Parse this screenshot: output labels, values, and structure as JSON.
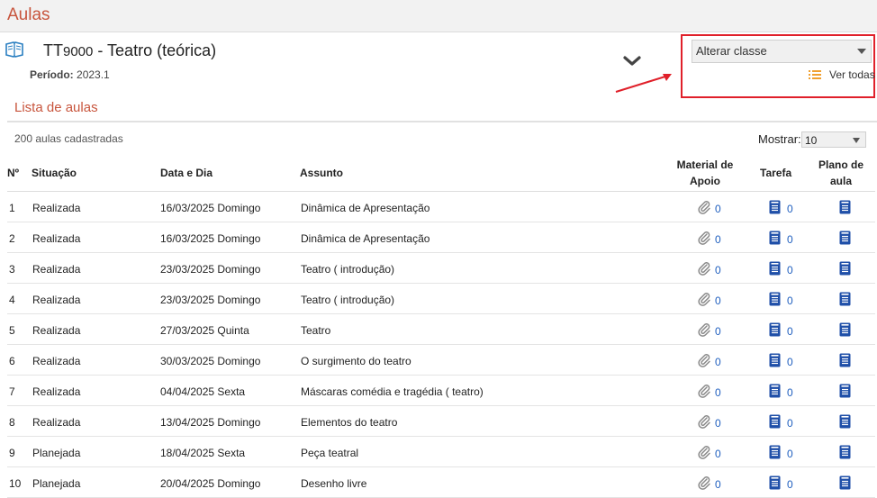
{
  "page": {
    "title": "Aulas"
  },
  "course": {
    "code_letters": "TT",
    "code_number": "9000",
    "name_suffix": " - Teatro (teórica)",
    "period_label": "Período:",
    "period_value": "2023.1"
  },
  "class_selector": {
    "label": "Alterar classe",
    "ver_todas": "Ver todas"
  },
  "list": {
    "title": "Lista de aulas",
    "count_text": "200 aulas cadastradas",
    "mostrar_label": "Mostrar:",
    "mostrar_value": "10"
  },
  "table": {
    "headers": {
      "num": "Nº",
      "situacao": "Situação",
      "data": "Data e Dia",
      "assunto": "Assunto",
      "material_1": "Material de",
      "material_2": "Apoio",
      "tarefa": "Tarefa",
      "plano_1": "Plano de",
      "plano_2": "aula"
    },
    "rows": [
      {
        "num": "1",
        "situacao": "Realizada",
        "data": "16/03/2025 Domingo",
        "assunto": "Dinâmica de Apresentação",
        "material": "0",
        "tarefa": "0"
      },
      {
        "num": "2",
        "situacao": "Realizada",
        "data": "16/03/2025 Domingo",
        "assunto": "Dinâmica de Apresentação",
        "material": "0",
        "tarefa": "0"
      },
      {
        "num": "3",
        "situacao": "Realizada",
        "data": "23/03/2025 Domingo",
        "assunto": "Teatro ( introdução)",
        "material": "0",
        "tarefa": "0"
      },
      {
        "num": "4",
        "situacao": "Realizada",
        "data": "23/03/2025 Domingo",
        "assunto": "Teatro ( introdução)",
        "material": "0",
        "tarefa": "0"
      },
      {
        "num": "5",
        "situacao": "Realizada",
        "data": "27/03/2025 Quinta",
        "assunto": "Teatro",
        "material": "0",
        "tarefa": "0"
      },
      {
        "num": "6",
        "situacao": "Realizada",
        "data": "30/03/2025 Domingo",
        "assunto": "O surgimento do teatro",
        "material": "0",
        "tarefa": "0"
      },
      {
        "num": "7",
        "situacao": "Realizada",
        "data": "04/04/2025 Sexta",
        "assunto": "Máscaras comédia e tragédia ( teatro)",
        "material": "0",
        "tarefa": "0"
      },
      {
        "num": "8",
        "situacao": "Realizada",
        "data": "13/04/2025 Domingo",
        "assunto": "Elementos do teatro",
        "material": "0",
        "tarefa": "0"
      },
      {
        "num": "9",
        "situacao": "Planejada",
        "data": "18/04/2025 Sexta",
        "assunto": "Peça teatral",
        "material": "0",
        "tarefa": "0"
      },
      {
        "num": "10",
        "situacao": "Planejada",
        "data": "20/04/2025 Domingo",
        "assunto": "Desenho livre",
        "material": "0",
        "tarefa": "0"
      }
    ]
  },
  "colors": {
    "accent": "#c8553d",
    "link": "#1f5fbf",
    "doc_icon": "#1f4fa8",
    "highlight": "#e0202a",
    "list_icon": "#f0a030"
  },
  "icons": [
    "book-icon",
    "chevron-down-icon",
    "list-icon",
    "paperclip-icon",
    "document-icon"
  ]
}
